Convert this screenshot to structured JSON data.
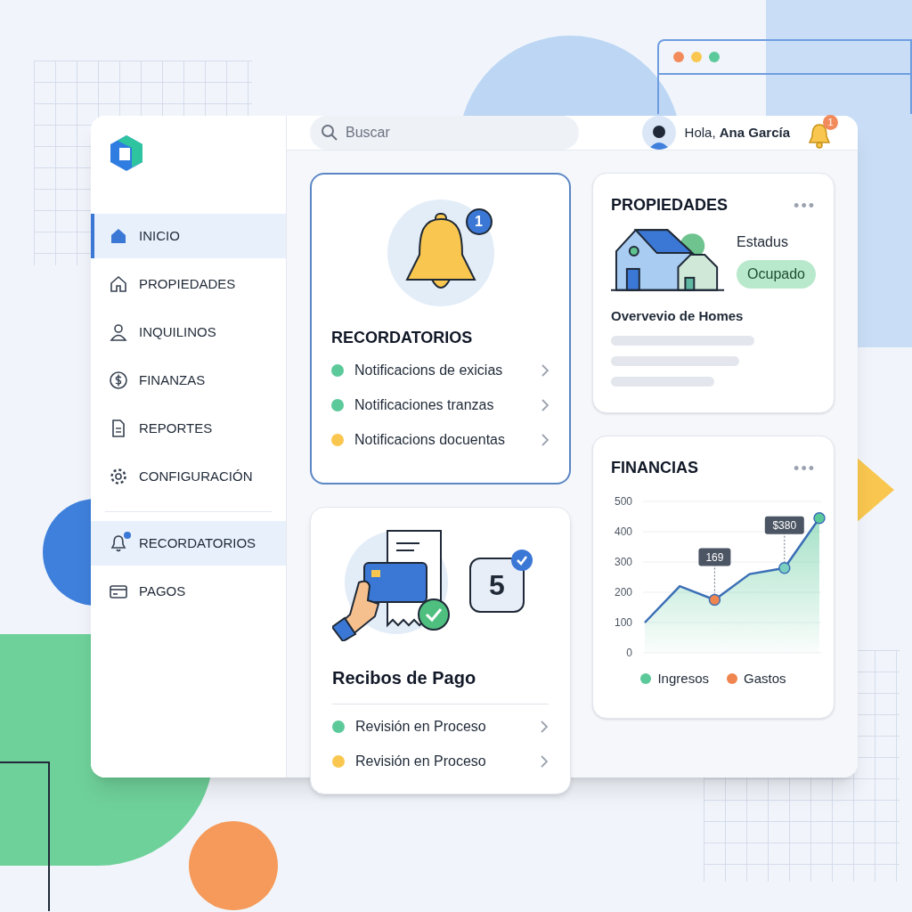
{
  "sidebar": {
    "items": [
      {
        "label": "INICIO",
        "selected": true,
        "notification": false
      },
      {
        "label": "PROPIEDADES",
        "selected": false,
        "notification": false
      },
      {
        "label": "INQUILINOS",
        "selected": false,
        "notification": false
      },
      {
        "label": "FINANZAS",
        "selected": false,
        "notification": false
      },
      {
        "label": "REPORTES",
        "selected": false,
        "notification": false
      },
      {
        "label": "CONFIGURACIÓN",
        "selected": false,
        "notification": false
      }
    ],
    "secondary_items": [
      {
        "label": "RECORDATORIOS",
        "highlighted": true,
        "notification": true
      },
      {
        "label": "PAGOS",
        "highlighted": false,
        "notification": false
      }
    ]
  },
  "header": {
    "search": {
      "placeholder": "Buscar"
    },
    "greeting": "Hola, **Ana García**",
    "notification_count": "1"
  },
  "reminders": {
    "badge": "1",
    "title": "RECORDATORIOS",
    "items": [
      {
        "label": "Notificacions de exicias",
        "color": "#5cc99a"
      },
      {
        "label": "Notificaciones tranzas",
        "color": "#5cc99a"
      },
      {
        "label": "Notificacions docuentas",
        "color": "#f9c74f"
      }
    ]
  },
  "receipts": {
    "count": "5",
    "title": "Recibos de Pago",
    "items": [
      {
        "label": "Revisión en Proceso",
        "color": "#5cc99a"
      },
      {
        "label": "Revisión en Proceso",
        "color": "#f9c74f"
      }
    ]
  },
  "properties": {
    "title": "PROPIEDADES",
    "more": "•••",
    "status_label": "Estadus",
    "status": "Ocupado",
    "subtitle": "Overvevio de Homes"
  },
  "finances": {
    "title": "FINANCIAS",
    "more": "•••",
    "chart_data": {
      "type": "area",
      "grid": true,
      "series": [
        {
          "name": "Ingresos",
          "color": "#5cc99a",
          "values": [
            100,
            220,
            175,
            260,
            280,
            445
          ]
        },
        {
          "name": "Gastos",
          "color": "#f08550",
          "values": [
            null,
            null,
            null,
            null,
            null,
            null
          ]
        }
      ],
      "ylim": [
        0,
        500
      ],
      "yticks": [
        0,
        100,
        200,
        300,
        400,
        500
      ]
    },
    "points": [
      {
        "marker": false
      },
      {
        "marker": false
      },
      {
        "marker": true,
        "color": "#f08550",
        "callout": "169"
      },
      {
        "marker": false
      },
      {
        "marker": true,
        "color": "#7ccfc0",
        "callout": "$380"
      },
      {
        "marker": true,
        "color": "#5cc99a"
      }
    ]
  }
}
